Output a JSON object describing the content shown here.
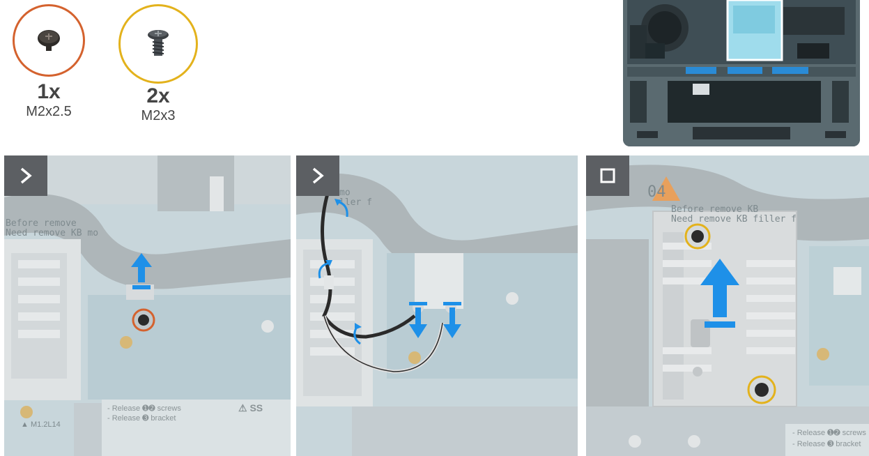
{
  "screws": [
    {
      "qty": "1x",
      "size": "M2x2.5",
      "ring_color": "#d4622e"
    },
    {
      "qty": "2x",
      "size": "M2x3",
      "ring_color": "#e3b21c"
    }
  ],
  "panels": [
    {
      "badge": "next-step",
      "silk_lines": [
        "Before remove",
        "Need remove KB mo"
      ],
      "sticker": {
        "lines": [
          "- Release ➊➋ screws",
          "- Release ➌ bracket"
        ],
        "warn": "⚠ SS"
      },
      "marking": "▲ M1.2L14"
    },
    {
      "badge": "next-step",
      "silk_lines": [
        "mo",
        "ller f"
      ]
    },
    {
      "badge": "final-step",
      "silk_lines": [
        "04",
        "Before remove KB",
        "Need remove KB filler f"
      ],
      "sticker": {
        "lines": [
          "- Release ➊➋ screws",
          "- Release ➌ bracket"
        ]
      }
    }
  ],
  "colors": {
    "arrow": "#1e90e8",
    "orange_highlight": "#d4622e",
    "yellow_highlight": "#e3b21c",
    "badge": "#5c5f63"
  }
}
